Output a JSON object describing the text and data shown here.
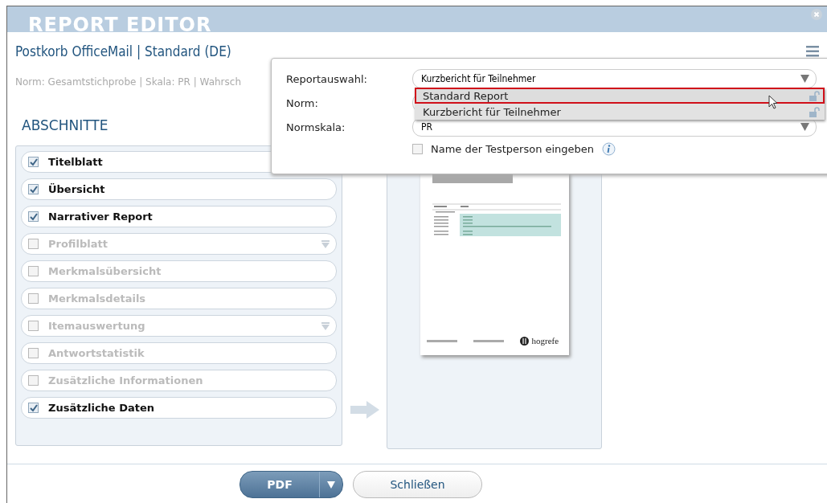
{
  "window": {
    "title": "REPORT EDITOR"
  },
  "header": {
    "title": "Postkorb OfficeMail | Standard (DE)",
    "subtitle": "Norm: Gesamtstichprobe | Skala: PR | Wahrsch"
  },
  "sections": {
    "heading": "ABSCHNITTE",
    "items": [
      {
        "label": "Titelblatt",
        "checked": true,
        "expandable": false
      },
      {
        "label": "Übersicht",
        "checked": true,
        "expandable": false
      },
      {
        "label": "Narrativer Report",
        "checked": true,
        "expandable": false
      },
      {
        "label": "Profilblatt",
        "checked": false,
        "expandable": true
      },
      {
        "label": "Merkmalsübersicht",
        "checked": false,
        "expandable": false
      },
      {
        "label": "Merkmalsdetails",
        "checked": false,
        "expandable": false
      },
      {
        "label": "Itemauswertung",
        "checked": false,
        "expandable": true
      },
      {
        "label": "Antwortstatistik",
        "checked": false,
        "expandable": false
      },
      {
        "label": "Zusätzliche Informationen",
        "checked": false,
        "expandable": false
      },
      {
        "label": "Zusätzliche Daten",
        "checked": true,
        "expandable": false
      }
    ]
  },
  "preview": {
    "logo_text": "hogrefe"
  },
  "settings_popup": {
    "fields": [
      {
        "kind": "select",
        "label": "Reportauswahl:",
        "value": "Kurzbericht für Teilnehmer"
      },
      {
        "kind": "select",
        "label": "Norm:"
      },
      {
        "kind": "select",
        "label": "Normskala:",
        "value": "PR"
      }
    ],
    "dropdown": {
      "options": [
        {
          "label": "Standard Report",
          "selected": true
        },
        {
          "label": "Kurzbericht für Teilnehmer",
          "selected": false
        }
      ]
    },
    "name_checkbox": {
      "label": "Name der Testperson eingeben",
      "checked": false
    }
  },
  "footer": {
    "buttons": [
      {
        "kind": "split",
        "label": "PDF"
      },
      {
        "kind": "plain",
        "label": "Schließen"
      }
    ]
  }
}
